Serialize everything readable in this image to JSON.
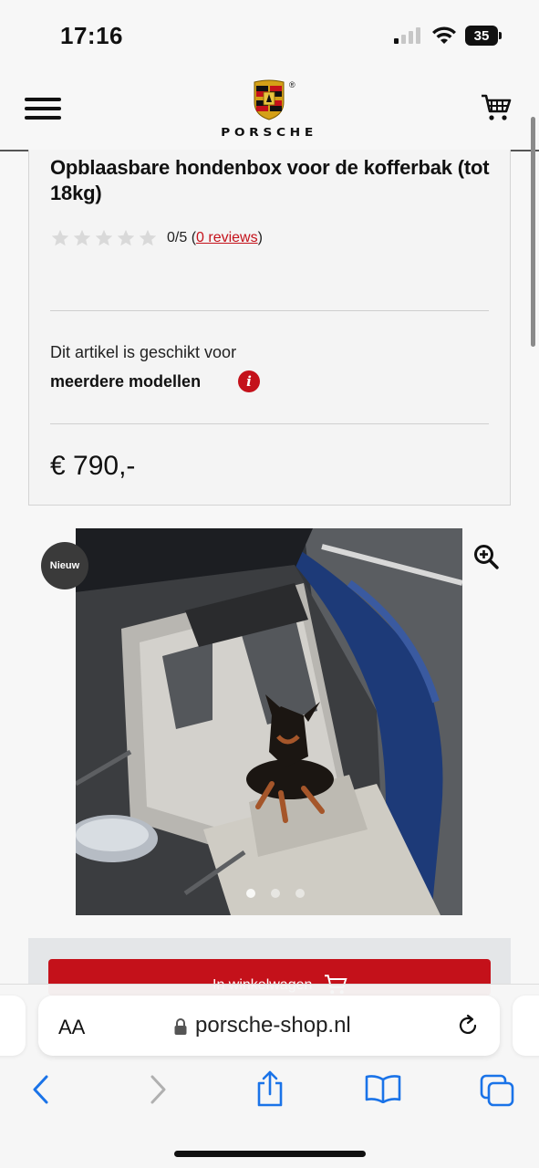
{
  "status_bar": {
    "time": "17:16",
    "battery": "35"
  },
  "header": {
    "brand": "PORSCHE",
    "registered": "®"
  },
  "product": {
    "title": "Opblaasbare hondenbox voor de kofferbak (tot 18kg)",
    "rating_score": "0/5",
    "rating_open": "(",
    "reviews_link": "0 reviews",
    "rating_close": ")",
    "compat_line1": "Dit artikel is geschikt voor",
    "compat_line2": "meerdere modellen",
    "info_icon": "i",
    "price": "€ 790,-"
  },
  "gallery": {
    "badge": "Nieuw",
    "image_count": 3,
    "active_index": 0
  },
  "cart_button": {
    "label": "In winkelwagen"
  },
  "browser": {
    "text_size": "AA",
    "url": "porsche-shop.nl"
  },
  "colors": {
    "accent": "#c4111a",
    "badge": "#3a3a3a"
  },
  "icons": [
    "menu-icon",
    "cart-icon",
    "star-icon",
    "info-icon",
    "zoom-in-icon",
    "lock-icon",
    "reload-icon",
    "back-icon",
    "forward-icon",
    "share-icon",
    "bookmarks-icon",
    "tabs-icon"
  ]
}
